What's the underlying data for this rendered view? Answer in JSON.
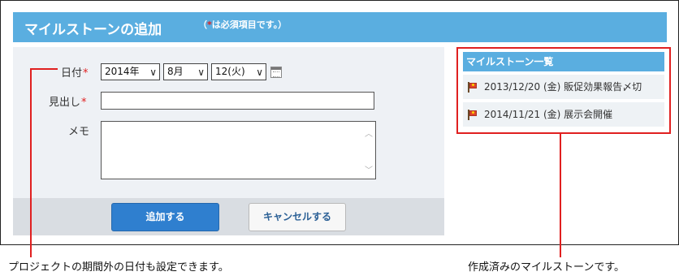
{
  "header": {
    "title": "マイルストーンの追加",
    "required_note_open": "（",
    "required_note_star": "*",
    "required_note_rest": "は必須項目です。）"
  },
  "form": {
    "date_label": "日付",
    "required_star": "*",
    "year": "2014年",
    "month": "8月",
    "day": "12(火)",
    "dropdown_arrow": "∨",
    "subject_label": "見出し",
    "subject_value": "",
    "memo_label": "メモ",
    "memo_value": ""
  },
  "buttons": {
    "add": "追加する",
    "cancel": "キャンセルする"
  },
  "milestones": {
    "heading": "マイルストーン一覧",
    "items": [
      {
        "label": "2013/12/20 (金) 販促効果報告〆切"
      },
      {
        "label": "2014/11/21 (金) 展示会開催"
      }
    ]
  },
  "annotations": {
    "left": "プロジェクトの期間外の日付も設定できます。",
    "right": "作成済みのマイルストーンです。"
  },
  "colors": {
    "header_blue": "#5aaee0",
    "button_blue": "#2f7fcf",
    "required_red": "#e02020",
    "callout_red": "#e02020"
  },
  "icons": [
    "calendar-icon",
    "milestone-flag-icon"
  ]
}
